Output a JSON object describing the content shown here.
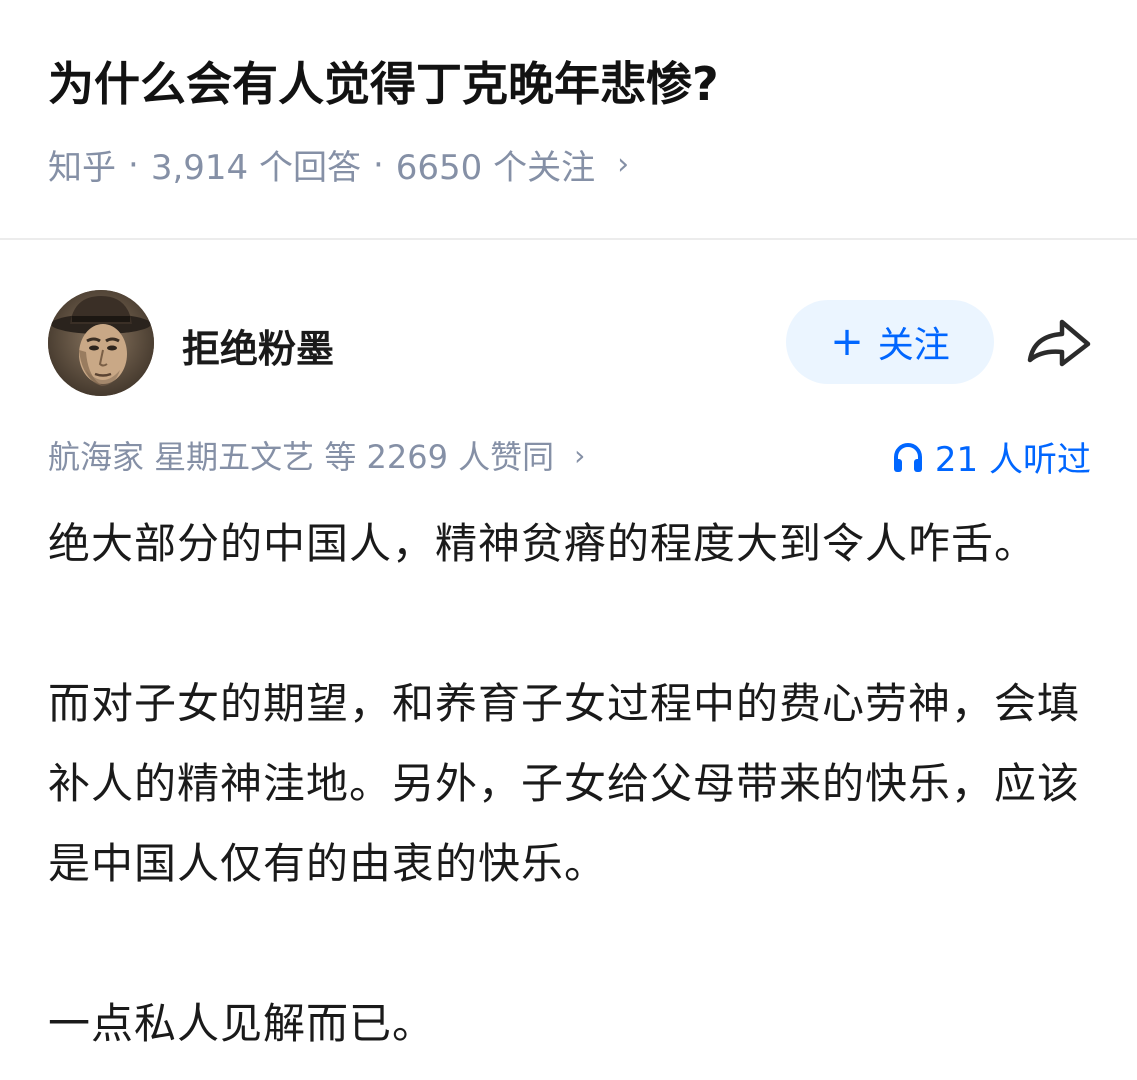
{
  "question": {
    "title": "为什么会有人觉得丁克晚年悲惨?",
    "source": "知乎",
    "answers_count": "3,914 个回答",
    "followers_count": "6650 个关注",
    "separator": "·",
    "chevron": "›"
  },
  "author": {
    "name": "拒绝粉墨",
    "follow_label": "关注",
    "follow_plus": "+"
  },
  "endorsement": {
    "text": "航海家 星期五文艺 等 2269 人赞同",
    "chevron": "›"
  },
  "listened": {
    "text": "21 人听过"
  },
  "answer": {
    "paragraphs": [
      "绝大部分的中国人，精神贫瘠的程度大到令人咋舌。",
      "而对子女的期望，和养育子女过程中的费心劳神，会填补人的精神洼地。另外，子女给父母带来的快乐，应该是中国人仅有的由衷的快乐。",
      "一点私人见解而已。"
    ]
  },
  "colors": {
    "accent": "#0066ff",
    "meta_gray": "#8590a6",
    "follow_bg": "#ebf5ff"
  },
  "icons": {
    "share": "share-arrow-icon",
    "headphones": "headphones-icon",
    "chevron": "chevron-right-icon"
  }
}
